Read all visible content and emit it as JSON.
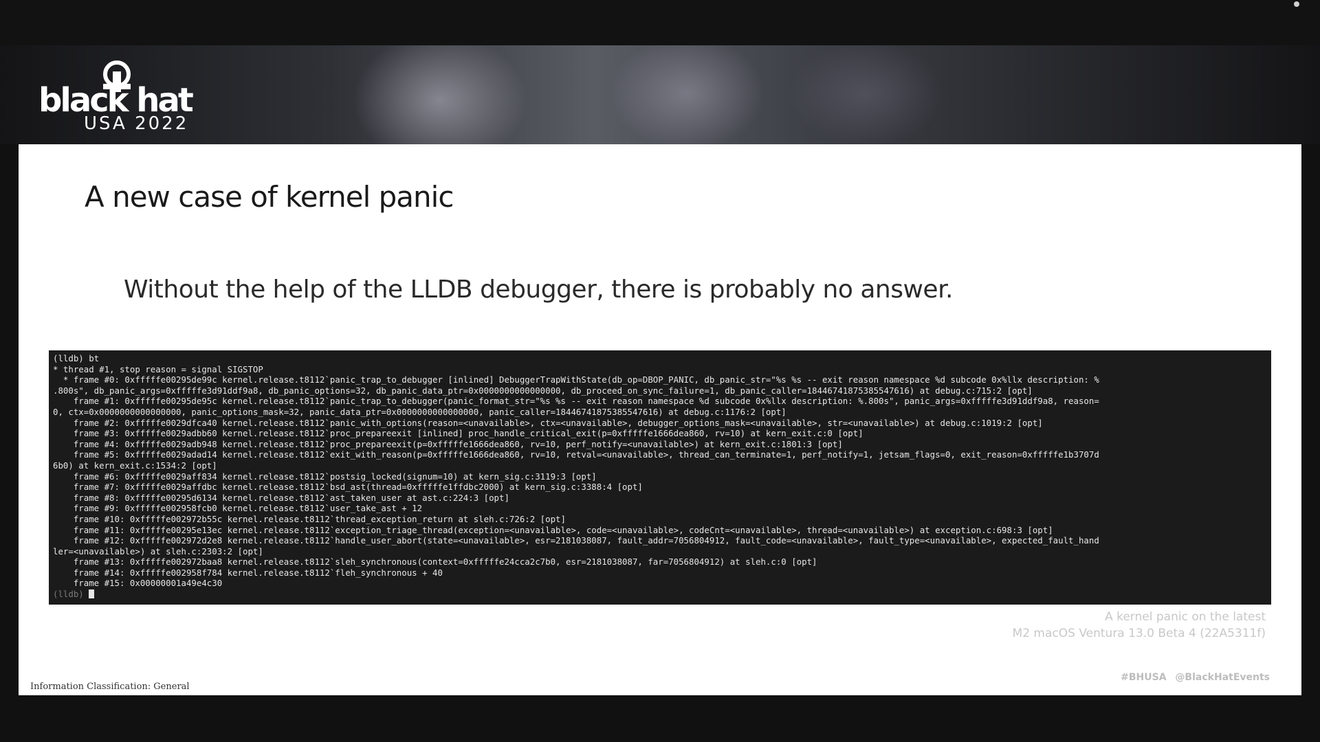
{
  "logo": {
    "wordmark": "black hat",
    "subline": "USA 2022"
  },
  "slide": {
    "title": "A new case of kernel panic",
    "subtitle": "Without the help of the LLDB debugger, there is probably no answer.",
    "caption_line1": "A kernel panic on the latest",
    "caption_line2": "M2 macOS Ventura 13.0 Beta 4 (22A5311f)",
    "classification": "Information Classification: General",
    "social": "#BHUSA   @BlackHatEvents"
  },
  "terminal": {
    "lines": [
      "(lldb) bt",
      "* thread #1, stop reason = signal SIGSTOP",
      "  * frame #0: 0xfffffe00295de99c kernel.release.t8112`panic_trap_to_debugger [inlined] DebuggerTrapWithState(db_op=DBOP_PANIC, db_panic_str=\"%s %s -- exit reason namespace %d subcode 0x%llx description: %",
      ".800s\", db_panic_args=0xfffffe3d91ddf9a8, db_panic_options=32, db_panic_data_ptr=0x0000000000000000, db_proceed_on_sync_failure=1, db_panic_caller=18446741875385547616) at debug.c:715:2 [opt]",
      "    frame #1: 0xfffffe00295de95c kernel.release.t8112`panic_trap_to_debugger(panic_format_str=\"%s %s -- exit reason namespace %d subcode 0x%llx description: %.800s\", panic_args=0xfffffe3d91ddf9a8, reason=",
      "0, ctx=0x0000000000000000, panic_options_mask=32, panic_data_ptr=0x0000000000000000, panic_caller=18446741875385547616) at debug.c:1176:2 [opt]",
      "    frame #2: 0xfffffe0029dfca40 kernel.release.t8112`panic_with_options(reason=<unavailable>, ctx=<unavailable>, debugger_options_mask=<unavailable>, str=<unavailable>) at debug.c:1019:2 [opt]",
      "    frame #3: 0xfffffe0029adbb60 kernel.release.t8112`proc_prepareexit [inlined] proc_handle_critical_exit(p=0xfffffe1666dea860, rv=10) at kern_exit.c:0 [opt]",
      "    frame #4: 0xfffffe0029adb948 kernel.release.t8112`proc_prepareexit(p=0xfffffe1666dea860, rv=10, perf_notify=<unavailable>) at kern_exit.c:1801:3 [opt]",
      "    frame #5: 0xfffffe0029adad14 kernel.release.t8112`exit_with_reason(p=0xfffffe1666dea860, rv=10, retval=<unavailable>, thread_can_terminate=1, perf_notify=1, jetsam_flags=0, exit_reason=0xfffffe1b3707d",
      "6b0) at kern_exit.c:1534:2 [opt]",
      "    frame #6: 0xfffffe0029aff834 kernel.release.t8112`postsig_locked(signum=10) at kern_sig.c:3119:3 [opt]",
      "    frame #7: 0xfffffe0029affdbc kernel.release.t8112`bsd_ast(thread=0xfffffe1ffdbc2000) at kern_sig.c:3388:4 [opt]",
      "    frame #8: 0xfffffe00295d6134 kernel.release.t8112`ast_taken_user at ast.c:224:3 [opt]",
      "    frame #9: 0xfffffe002958fcb0 kernel.release.t8112`user_take_ast + 12",
      "    frame #10: 0xfffffe002972b55c kernel.release.t8112`thread_exception_return at sleh.c:726:2 [opt]",
      "    frame #11: 0xfffffe00295e13ec kernel.release.t8112`exception_triage_thread(exception=<unavailable>, code=<unavailable>, codeCnt=<unavailable>, thread=<unavailable>) at exception.c:698:3 [opt]",
      "    frame #12: 0xfffffe002972d2e8 kernel.release.t8112`handle_user_abort(state=<unavailable>, esr=2181038087, fault_addr=7056804912, fault_code=<unavailable>, fault_type=<unavailable>, expected_fault_hand",
      "ler=<unavailable>) at sleh.c:2303:2 [opt]",
      "    frame #13: 0xfffffe002972baa8 kernel.release.t8112`sleh_synchronous(context=0xfffffe24cca2c7b0, esr=2181038087, far=7056804912) at sleh.c:0 [opt]",
      "    frame #14: 0xfffffe002958f784 kernel.release.t8112`fleh_synchronous + 40",
      "    frame #15: 0x00000001a49e4c30",
      "(lldb) "
    ]
  },
  "colors": {
    "terminal_bg": "#1b1b1b",
    "terminal_text": "#e6e6e6",
    "terminal_dim": "#7a7a7a",
    "slide_bg": "#ffffff"
  }
}
